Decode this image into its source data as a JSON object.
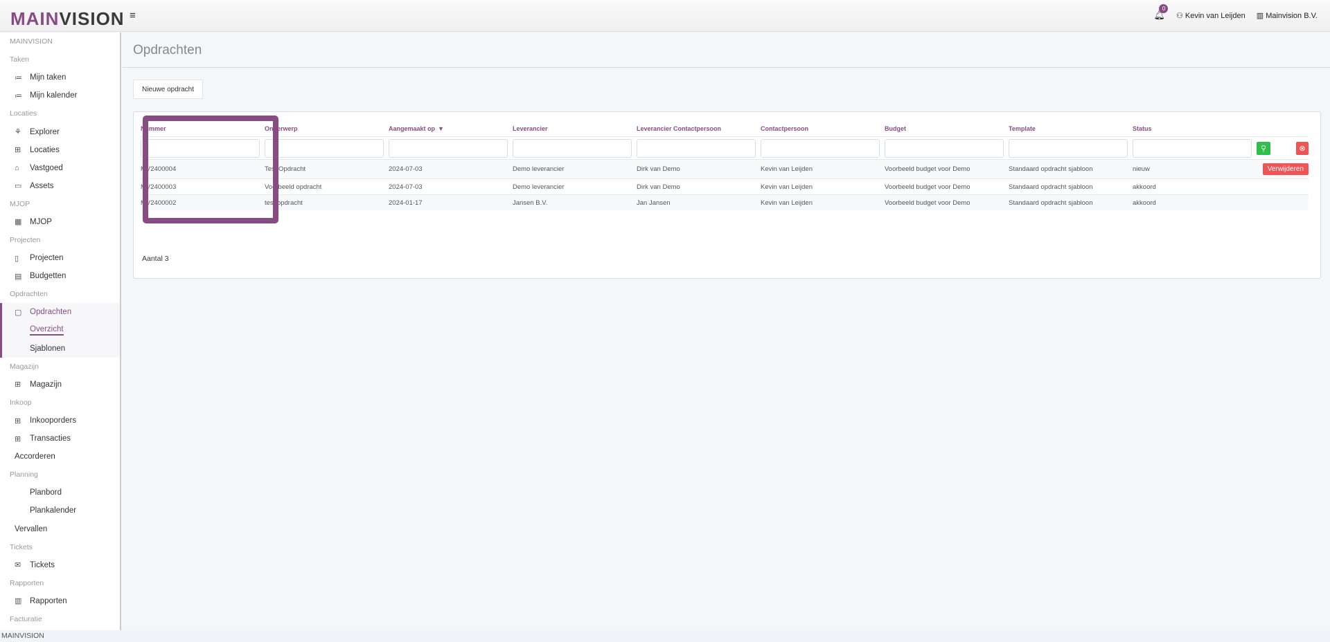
{
  "topbar": {
    "logo": "MAINVISION",
    "logo_a": "MAIN",
    "logo_b": "VISION",
    "notifications": "0",
    "user": "Kevin van Leijden",
    "company": "Mainvision B.V."
  },
  "sidebar": [
    {
      "type": "sec",
      "label": "MAINVISION"
    },
    {
      "type": "sec",
      "label": "Taken"
    },
    {
      "type": "item",
      "icon": "≔",
      "name": "list-icon",
      "label": "Mijn taken"
    },
    {
      "type": "item",
      "icon": "≔",
      "name": "list-icon",
      "label": "Mijn kalender"
    },
    {
      "type": "sec",
      "label": "Locaties"
    },
    {
      "type": "item",
      "icon": "⚘",
      "name": "sitemap-icon",
      "label": "Explorer"
    },
    {
      "type": "item",
      "icon": "⊞",
      "name": "briefcase-icon",
      "label": "Locaties"
    },
    {
      "type": "item",
      "icon": "⌂",
      "name": "home-icon",
      "label": "Vastgoed"
    },
    {
      "type": "item",
      "icon": "▭",
      "name": "folder-icon",
      "label": "Assets"
    },
    {
      "type": "sec",
      "label": "MJOP"
    },
    {
      "type": "item",
      "icon": "▦",
      "name": "calendar-icon",
      "label": "MJOP"
    },
    {
      "type": "sec",
      "label": "Projecten"
    },
    {
      "type": "item",
      "icon": "▯",
      "name": "notebook-icon",
      "label": "Projecten"
    },
    {
      "type": "item",
      "icon": "▤",
      "name": "budget-icon",
      "label": "Budgetten"
    },
    {
      "type": "sec",
      "label": "Opdrachten"
    },
    {
      "type": "item",
      "icon": "▢",
      "name": "document-icon",
      "label": "Opdrachten",
      "active": true
    },
    {
      "type": "sub",
      "label": "Overzicht",
      "active": true,
      "current": true
    },
    {
      "type": "sub",
      "label": "Sjablonen",
      "active": true
    },
    {
      "type": "sec",
      "label": "Magazijn"
    },
    {
      "type": "item",
      "icon": "⊞",
      "name": "grid-icon",
      "label": "Magazijn"
    },
    {
      "type": "sec",
      "label": "Inkoop"
    },
    {
      "type": "item",
      "icon": "⊞",
      "name": "grid-icon",
      "label": "Inkooporders"
    },
    {
      "type": "item",
      "icon": "⊞",
      "name": "grid-icon",
      "label": "Transacties"
    },
    {
      "type": "plain",
      "label": "Accorderen"
    },
    {
      "type": "sec",
      "label": "Planning"
    },
    {
      "type": "sub",
      "label": "Planbord"
    },
    {
      "type": "sub",
      "label": "Plankalender"
    },
    {
      "type": "plain",
      "label": "Vervallen"
    },
    {
      "type": "sec",
      "label": "Tickets"
    },
    {
      "type": "item",
      "icon": "✉",
      "name": "envelope-icon",
      "label": "Tickets"
    },
    {
      "type": "sec",
      "label": "Rapporten"
    },
    {
      "type": "item",
      "icon": "▥",
      "name": "book-icon",
      "label": "Rapporten"
    },
    {
      "type": "sec",
      "label": "Facturatie"
    }
  ],
  "footer": "MAINVISION",
  "page": {
    "title": "Opdrachten",
    "new_button": "Nieuwe opdracht",
    "count": "Aantal 3",
    "delete_label": "Verwijderen",
    "sort_indicator": "▼"
  },
  "table": {
    "columns": [
      "Nummer",
      "Onderwerp",
      "Aangemaakt op",
      "Leverancier",
      "Leverancier Contactpersoon",
      "Contactpersoon",
      "Budget",
      "Template",
      "Status"
    ],
    "rows": [
      [
        "MV2400004",
        "Test Opdracht",
        "2024-07-03",
        "Demo leverancier",
        "Dirk van Demo",
        "Kevin van Leijden",
        "Voorbeeld budget voor Demo",
        "Standaard opdracht sjabloon",
        "nieuw"
      ],
      [
        "MV2400003",
        "Voorbeeld opdracht",
        "2024-07-03",
        "Demo leverancier",
        "Dirk van Demo",
        "Kevin van Leijden",
        "Voorbeeld budget voor Demo",
        "Standaard opdracht sjabloon",
        "akkoord"
      ],
      [
        "MV2400002",
        "test opdracht",
        "2024-01-17",
        "Jansen B.V.",
        "Jan Jansen",
        "Kevin van Leijden",
        "Voorbeeld budget voor Demo",
        "Standaard opdracht sjabloon",
        "akkoord"
      ]
    ]
  },
  "colors": {
    "accent": "#874c84",
    "search": "#2fbf4a",
    "danger": "#f05454"
  }
}
